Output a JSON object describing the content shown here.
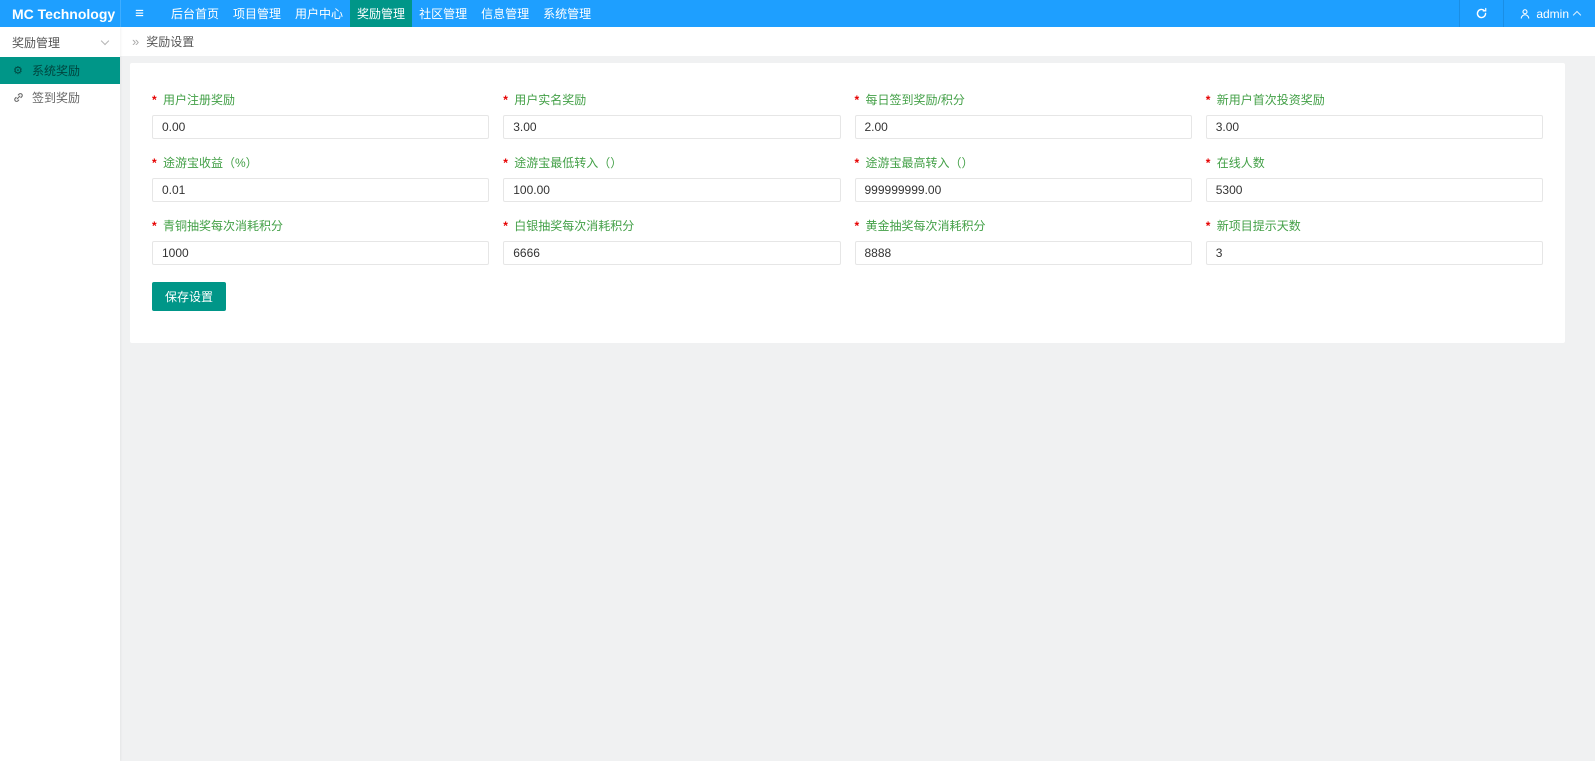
{
  "topbar": {
    "logo": "MC Technology",
    "nav": [
      {
        "label": "后台首页",
        "active": false
      },
      {
        "label": "项目管理",
        "active": false
      },
      {
        "label": "用户中心",
        "active": false
      },
      {
        "label": "奖励管理",
        "active": true
      },
      {
        "label": "社区管理",
        "active": false
      },
      {
        "label": "信息管理",
        "active": false
      },
      {
        "label": "系统管理",
        "active": false
      }
    ],
    "user": {
      "name": "admin"
    }
  },
  "sidebar": {
    "section": "奖励管理",
    "items": [
      {
        "label": "系统奖励",
        "icon": "gear-icon",
        "active": true
      },
      {
        "label": "签到奖励",
        "icon": "link-icon",
        "active": false
      }
    ]
  },
  "breadcrumb": {
    "arrow": "»",
    "title": "奖励设置"
  },
  "form": {
    "required_marker": "*",
    "fields": [
      {
        "label": "用户注册奖励",
        "value": "0.00"
      },
      {
        "label": "用户实名奖励",
        "value": "3.00"
      },
      {
        "label": "每日签到奖励/积分",
        "value": "2.00"
      },
      {
        "label": "新用户首次投资奖励",
        "value": "3.00"
      },
      {
        "label": "途游宝收益（%）",
        "value": "0.01"
      },
      {
        "label": "途游宝最低转入（）",
        "value": "100.00"
      },
      {
        "label": "途游宝最高转入（）",
        "value": "999999999.00"
      },
      {
        "label": "在线人数",
        "value": "5300"
      },
      {
        "label": "青铜抽奖每次消耗积分",
        "value": "1000"
      },
      {
        "label": "白银抽奖每次消耗积分",
        "value": "6666"
      },
      {
        "label": "黄金抽奖每次消耗积分",
        "value": "8888"
      },
      {
        "label": "新项目提示天数",
        "value": "3"
      }
    ],
    "save_label": "保存设置"
  },
  "colors": {
    "topbar_blue": "#1E9FFF",
    "accent_green": "#009688",
    "label_green": "#43a047",
    "required_red": "#e60000",
    "page_background": "#f0f1f2"
  }
}
